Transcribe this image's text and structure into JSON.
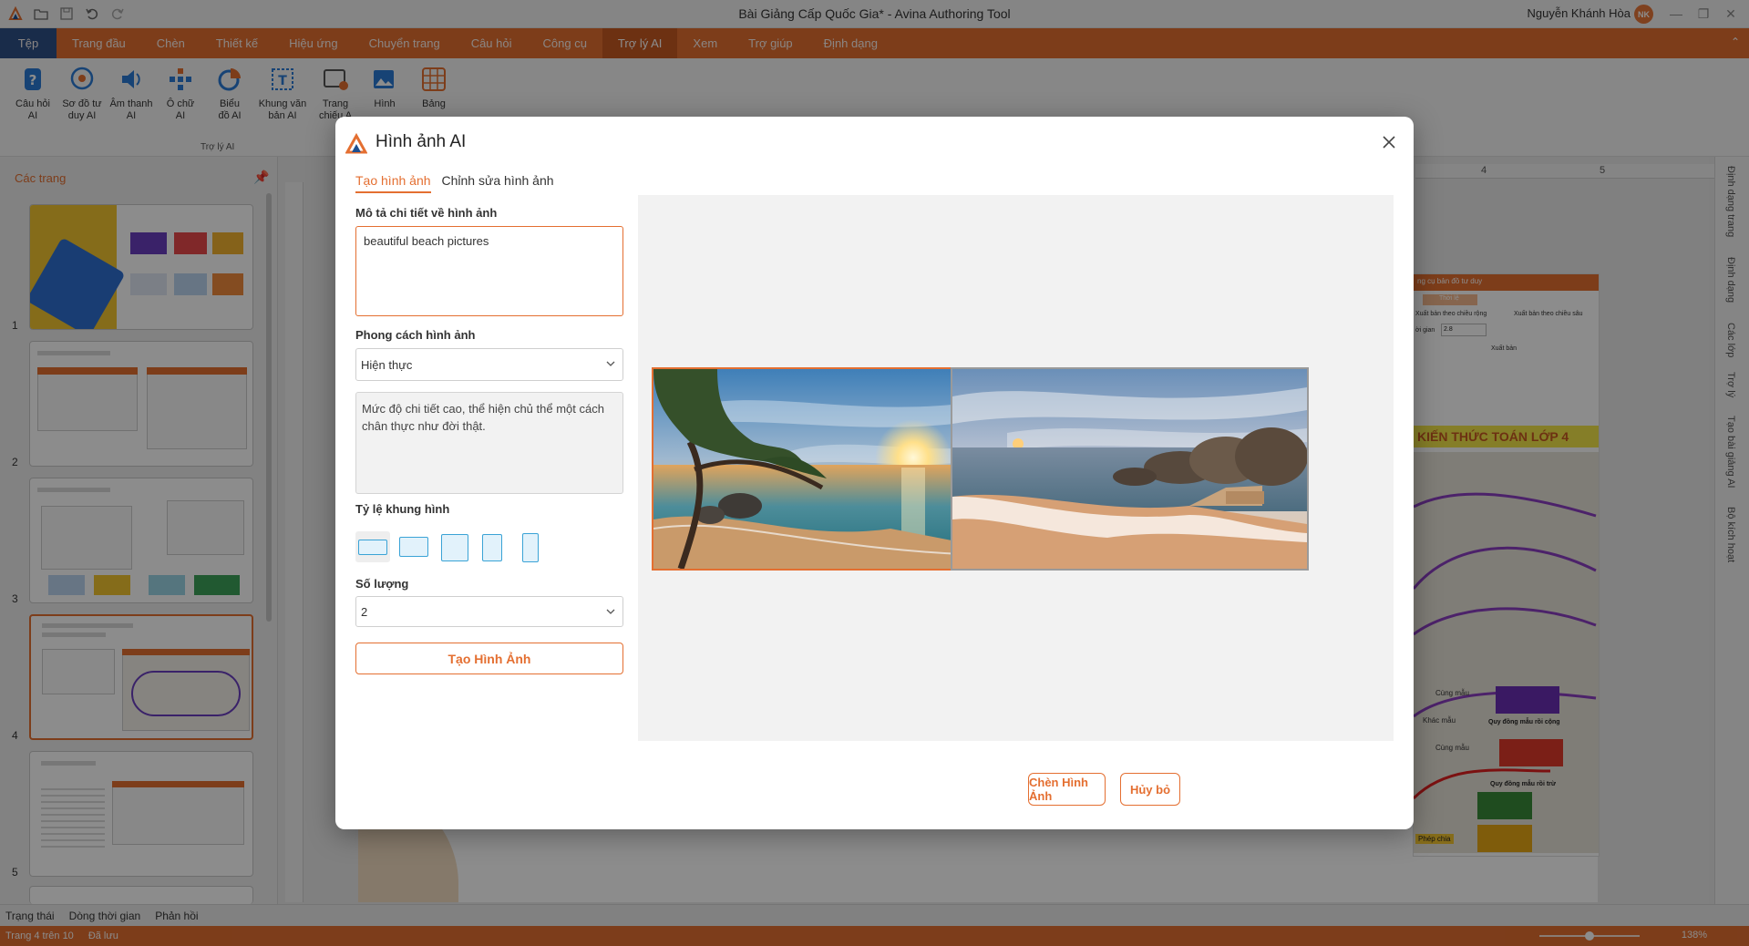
{
  "app": {
    "window_title": "Bài Giảng Cấp Quốc Gia* - Avina Authoring Tool",
    "user_name": "Nguyễn Khánh Hòa",
    "user_initials": "NK"
  },
  "menu": {
    "tabs": [
      "Tệp",
      "Trang đầu",
      "Chèn",
      "Thiết kế",
      "Hiệu ứng",
      "Chuyển trang",
      "Câu hỏi",
      "Công cụ",
      "Trợ lý AI",
      "Xem",
      "Trợ giúp",
      "Định dạng"
    ],
    "active": "Trợ lý AI"
  },
  "ribbon": {
    "group_label": "Trợ lý AI",
    "buttons": [
      {
        "label1": "Câu hỏi",
        "label2": "AI"
      },
      {
        "label1": "Sơ đồ tư",
        "label2": "duy AI"
      },
      {
        "label1": "Âm thanh",
        "label2": "AI"
      },
      {
        "label1": "Ô chữ",
        "label2": "AI"
      },
      {
        "label1": "Biểu",
        "label2": "đồ AI"
      },
      {
        "label1": "Khung văn",
        "label2": "bản AI"
      },
      {
        "label1": "Trang",
        "label2": "chiếu A"
      },
      {
        "label1": "Hình",
        "label2": ""
      },
      {
        "label1": "Bảng",
        "label2": ""
      }
    ]
  },
  "slides_panel": {
    "header": "Các trang",
    "numbers": [
      "1",
      "2",
      "3",
      "4",
      "5"
    ],
    "selected": 4
  },
  "right_sidebar": {
    "tabs": [
      "Định dạng trang",
      "Định dạng",
      "Các lớp",
      "Trợ lý",
      "Tạo bài giảng AI",
      "Bộ kích hoạt"
    ]
  },
  "ruler": {
    "h_labels": [
      "4",
      "5"
    ]
  },
  "background_slide": {
    "title": "KIẾN THỨC TOÁN LỚP 4",
    "panel_header": "ng cụ bản đồ tư duy",
    "panel_tab": "Thời lệ",
    "label_export_wide": "Xuất bản theo chiều rộng",
    "label_export_deep": "Xuất bản theo chiều sâu",
    "label_time": "ời gian",
    "time_value": "2.8",
    "export_button": "Xuất bản",
    "node_cung_mau": "Cùng mẫu",
    "node_khac_mau": "Khác mẫu",
    "node_quy_dong_cong": "Quy đồng mẫu rồi cộng",
    "node_quy_dong_tru": "Quy đồng mẫu rồi trừ",
    "node_phep_chia": "Phép chia"
  },
  "status": {
    "tabs": [
      "Trạng thái",
      "Dòng thời gian",
      "Phản hồi"
    ],
    "page_info": "Trang 4 trên 10",
    "saved": "Đã lưu",
    "zoom": "138%"
  },
  "dialog": {
    "title": "Hình ảnh AI",
    "tabs": [
      "Tạo hình ảnh",
      "Chỉnh sửa hình ảnh"
    ],
    "active_tab": "Tạo hình ảnh",
    "description_label": "Mô tả chi tiết về hình ảnh",
    "description_value": "beautiful beach pictures",
    "style_label": "Phong cách hình ảnh",
    "style_value": "Hiện thực",
    "style_description": "Mức độ chi tiết cao, thể hiện chủ thể một cách chân thực như đời thật.",
    "ratio_label": "Tỷ lệ khung hình",
    "ratio_selected_index": 0,
    "quantity_label": "Số lượng",
    "quantity_value": "2",
    "generate_button": "Tạo Hình Ảnh",
    "insert_button": "Chèn Hình Ảnh",
    "cancel_button": "Hủy bỏ",
    "selected_image_index": 0
  },
  "colors": {
    "accent": "#e46f31",
    "file_tab": "#1f4f8f",
    "ratio_blue": "#3aa3d6"
  }
}
